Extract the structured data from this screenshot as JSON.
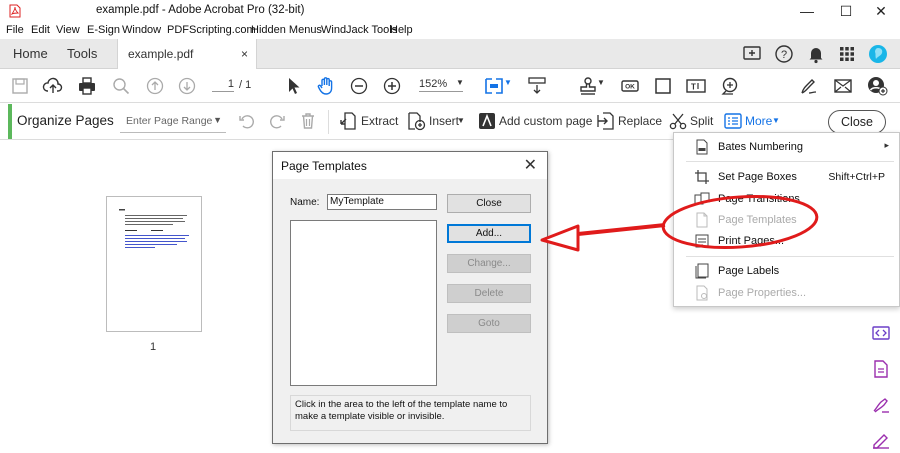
{
  "window": {
    "title": "example.pdf - Adobe Acrobat Pro (32-bit)",
    "minimize": "—",
    "maximize": "☐",
    "close": "✕"
  },
  "menubar": [
    "File",
    "Edit",
    "View",
    "E-Sign",
    "Window",
    "PDFScripting.com",
    "Hidden Menus",
    "WindJack Tools",
    "Help"
  ],
  "tabs": {
    "home": "Home",
    "tools": "Tools",
    "doc": "example.pdf",
    "doc_close": "×"
  },
  "toolbar": {
    "page_current": "1",
    "page_total": "/ 1",
    "zoom": "152%"
  },
  "organize": {
    "title": "Organize Pages",
    "range_placeholder": "Enter Page Range",
    "extract": "Extract",
    "insert": "Insert",
    "add_custom_page": "Add custom page",
    "replace": "Replace",
    "split": "Split",
    "more": "More",
    "close": "Close"
  },
  "thumbnail": {
    "page_number": "1"
  },
  "dialog": {
    "title": "Page Templates",
    "name_label": "Name:",
    "name_value": "MyTemplate",
    "buttons": {
      "close": "Close",
      "add": "Add...",
      "change": "Change...",
      "delete": "Delete",
      "goto": "Goto"
    },
    "hint": "Click in the area to the left of the template name to make a template visible or invisible."
  },
  "more_menu": {
    "items": [
      {
        "label": "Bates Numbering",
        "shortcut": "",
        "submenu": true,
        "disabled": false
      },
      {
        "label": "Set Page Boxes",
        "shortcut": "Shift+Ctrl+P",
        "submenu": false,
        "disabled": false
      },
      {
        "label": "Page Transitions",
        "shortcut": "",
        "submenu": false,
        "disabled": false
      },
      {
        "label": "Page Templates",
        "shortcut": "",
        "submenu": false,
        "disabled": true
      },
      {
        "label": "Print Pages...",
        "shortcut": "",
        "submenu": false,
        "disabled": false
      },
      {
        "label": "Page Labels",
        "shortcut": "",
        "submenu": false,
        "disabled": false
      },
      {
        "label": "Page Properties...",
        "shortcut": "",
        "submenu": false,
        "disabled": true
      }
    ]
  },
  "colors": {
    "accent_green": "#5cb85c",
    "annotation_red": "#e01b1b",
    "primary_blue": "#1473e6",
    "rail_purple": "#9b2fae"
  }
}
